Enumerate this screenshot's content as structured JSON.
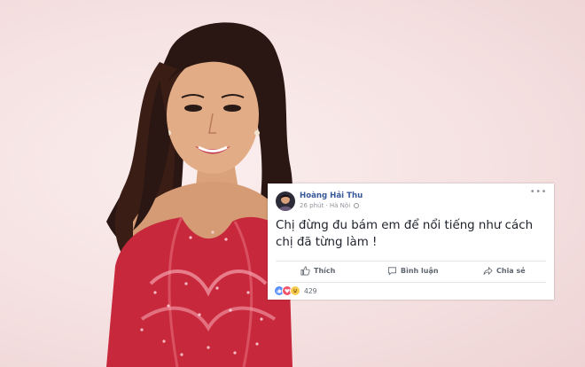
{
  "post": {
    "author": "Hoàng Hải Thu",
    "time": "26 phút",
    "location": "Hà Nội",
    "text": "Chị đừng đu bám em để nổi tiếng như cách chị đã từng làm !",
    "more_icon": "more-horizontal-icon",
    "actions": {
      "like": "Thích",
      "comment": "Bình luận",
      "share": "Chia sẻ"
    },
    "reaction_count": "429",
    "reactions": [
      "like-icon",
      "love-icon",
      "haha-icon"
    ]
  },
  "colors": {
    "link_blue": "#365899",
    "background_pink": "#f3dddd",
    "dress_red": "#c8283c",
    "like": "#5890ff",
    "love": "#f25268",
    "haha": "#f7cb4d"
  }
}
